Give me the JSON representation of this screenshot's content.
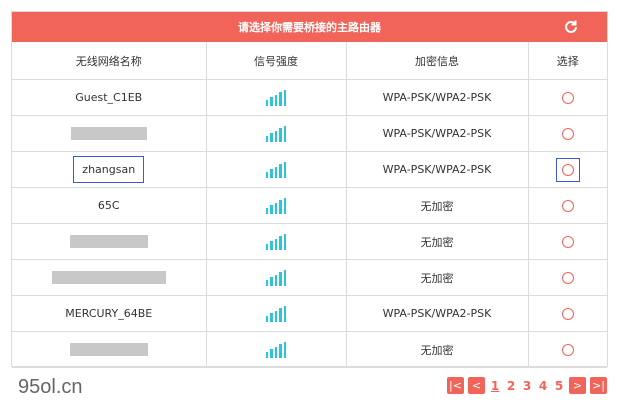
{
  "header": {
    "title": "请选择你需要桥接的主路由器",
    "refresh_icon": "refresh-icon"
  },
  "table": {
    "columns": [
      "无线网络名称",
      "信号强度",
      "加密信息",
      "选择"
    ],
    "rows": [
      {
        "ssid": "Guest_C1EB",
        "hidden": false,
        "signal_bars": 5,
        "security": "WPA-PSK/WPA2-PSK",
        "selected": false
      },
      {
        "ssid": "",
        "hidden": true,
        "signal_bars": 5,
        "security": "WPA-PSK/WPA2-PSK",
        "selected": false
      },
      {
        "ssid": "zhangsan",
        "hidden": false,
        "signal_bars": 5,
        "security": "WPA-PSK/WPA2-PSK",
        "selected": true
      },
      {
        "ssid": "65C",
        "hidden": false,
        "signal_bars": 5,
        "security": "无加密",
        "selected": false
      },
      {
        "ssid": "",
        "hidden": true,
        "signal_bars": 5,
        "security": "无加密",
        "selected": false
      },
      {
        "ssid": "",
        "hidden": true,
        "signal_bars": 5,
        "security": "无加密",
        "selected": false
      },
      {
        "ssid": "MERCURY_64BE",
        "hidden": false,
        "signal_bars": 5,
        "security": "WPA-PSK/WPA2-PSK",
        "selected": false
      },
      {
        "ssid": "",
        "hidden": true,
        "signal_bars": 5,
        "security": "无加密",
        "selected": false
      }
    ]
  },
  "pagination": {
    "first": "|<",
    "prev": "<",
    "next": ">",
    "last": ">|",
    "pages": [
      "1",
      "2",
      "3",
      "4",
      "5"
    ],
    "current": "1"
  },
  "watermark": "95ol.cn",
  "colors": {
    "accent": "#f0645a",
    "signal": "#2cc4d8",
    "highlight": "#3a5bd8"
  }
}
